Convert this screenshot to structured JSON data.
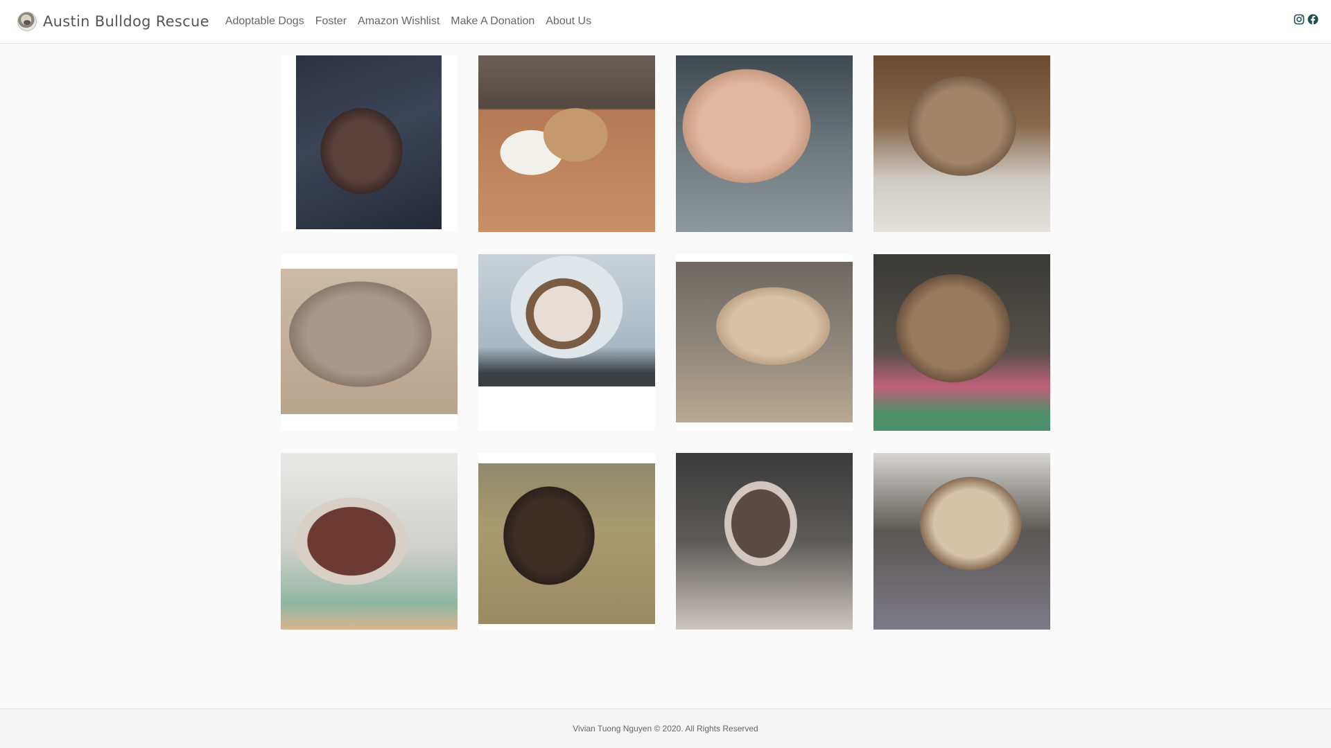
{
  "brand": {
    "title": "Austin Bulldog Rescue",
    "logo_icon": "bulldog-logo-icon"
  },
  "nav": {
    "items": [
      {
        "label": "Adoptable Dogs"
      },
      {
        "label": "Foster"
      },
      {
        "label": "Amazon Wishlist"
      },
      {
        "label": "Make A Donation"
      },
      {
        "label": "About Us"
      }
    ]
  },
  "social": {
    "icons": [
      "instagram-icon",
      "facebook-icon"
    ],
    "color": "#1f4f57"
  },
  "gallery": {
    "photos": [
      {
        "name": "dog-photo-1"
      },
      {
        "name": "dog-photo-2"
      },
      {
        "name": "dog-photo-3"
      },
      {
        "name": "dog-photo-4"
      },
      {
        "name": "dog-photo-5"
      },
      {
        "name": "dog-photo-6"
      },
      {
        "name": "dog-photo-7"
      },
      {
        "name": "dog-photo-8"
      },
      {
        "name": "dog-photo-9"
      },
      {
        "name": "dog-photo-10"
      },
      {
        "name": "dog-photo-11"
      },
      {
        "name": "dog-photo-12"
      }
    ]
  },
  "footer": {
    "text": "Vivian Tuong Nguyen © 2020. All Rights Reserved"
  },
  "colors": {
    "background": "#fafafa",
    "navbar": "#ffffff",
    "footer": "#f4f4f4"
  }
}
